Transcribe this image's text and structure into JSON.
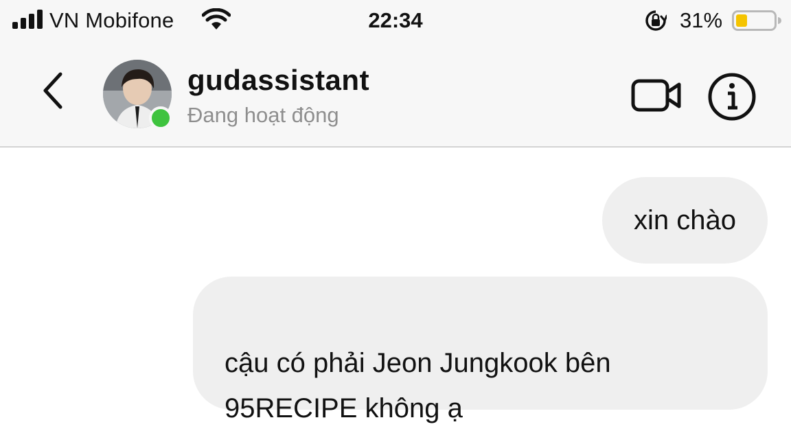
{
  "status_bar": {
    "carrier": "VN Mobifone",
    "time": "22:34",
    "battery_percent": "31%",
    "battery_level": 0.31,
    "icons": [
      "signal-bars-icon",
      "wifi-icon",
      "rotation-lock-icon",
      "battery-icon"
    ]
  },
  "header": {
    "username": "gudassistant",
    "presence": "Đang hoạt động",
    "icons": [
      "chevron-left-icon",
      "video-camera-icon",
      "info-icon"
    ],
    "active_color": "#3ec33e"
  },
  "messages": [
    {
      "direction": "outgoing",
      "text": "xin chào"
    },
    {
      "direction": "outgoing",
      "text": "cậu có phải Jeon Jungkook bên\n95RECIPE không ạ"
    }
  ],
  "colors": {
    "bubble_background": "#efefef",
    "header_background": "#f7f7f7",
    "battery_fill": "#f5c400"
  }
}
